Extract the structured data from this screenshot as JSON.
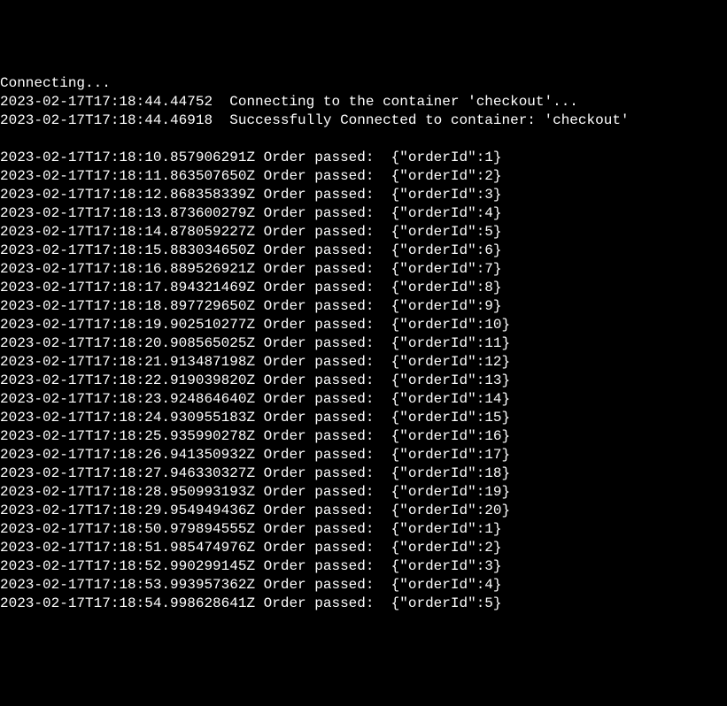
{
  "header": {
    "connecting_status": "Connecting...",
    "lines": [
      {
        "timestamp": "2023-02-17T17:18:44.44752",
        "message": "Connecting to the container 'checkout'..."
      },
      {
        "timestamp": "2023-02-17T17:18:44.46918",
        "message": "Successfully Connected to container: 'checkout'"
      }
    ]
  },
  "log_lines": [
    {
      "timestamp": "2023-02-17T17:18:10.857906291Z",
      "label": "Order passed:",
      "payload": "{\"orderId\":1}"
    },
    {
      "timestamp": "2023-02-17T17:18:11.863507650Z",
      "label": "Order passed:",
      "payload": "{\"orderId\":2}"
    },
    {
      "timestamp": "2023-02-17T17:18:12.868358339Z",
      "label": "Order passed:",
      "payload": "{\"orderId\":3}"
    },
    {
      "timestamp": "2023-02-17T17:18:13.873600279Z",
      "label": "Order passed:",
      "payload": "{\"orderId\":4}"
    },
    {
      "timestamp": "2023-02-17T17:18:14.878059227Z",
      "label": "Order passed:",
      "payload": "{\"orderId\":5}"
    },
    {
      "timestamp": "2023-02-17T17:18:15.883034650Z",
      "label": "Order passed:",
      "payload": "{\"orderId\":6}"
    },
    {
      "timestamp": "2023-02-17T17:18:16.889526921Z",
      "label": "Order passed:",
      "payload": "{\"orderId\":7}"
    },
    {
      "timestamp": "2023-02-17T17:18:17.894321469Z",
      "label": "Order passed:",
      "payload": "{\"orderId\":8}"
    },
    {
      "timestamp": "2023-02-17T17:18:18.897729650Z",
      "label": "Order passed:",
      "payload": "{\"orderId\":9}"
    },
    {
      "timestamp": "2023-02-17T17:18:19.902510277Z",
      "label": "Order passed:",
      "payload": "{\"orderId\":10}"
    },
    {
      "timestamp": "2023-02-17T17:18:20.908565025Z",
      "label": "Order passed:",
      "payload": "{\"orderId\":11}"
    },
    {
      "timestamp": "2023-02-17T17:18:21.913487198Z",
      "label": "Order passed:",
      "payload": "{\"orderId\":12}"
    },
    {
      "timestamp": "2023-02-17T17:18:22.919039820Z",
      "label": "Order passed:",
      "payload": "{\"orderId\":13}"
    },
    {
      "timestamp": "2023-02-17T17:18:23.924864640Z",
      "label": "Order passed:",
      "payload": "{\"orderId\":14}"
    },
    {
      "timestamp": "2023-02-17T17:18:24.930955183Z",
      "label": "Order passed:",
      "payload": "{\"orderId\":15}"
    },
    {
      "timestamp": "2023-02-17T17:18:25.935990278Z",
      "label": "Order passed:",
      "payload": "{\"orderId\":16}"
    },
    {
      "timestamp": "2023-02-17T17:18:26.941350932Z",
      "label": "Order passed:",
      "payload": "{\"orderId\":17}"
    },
    {
      "timestamp": "2023-02-17T17:18:27.946330327Z",
      "label": "Order passed:",
      "payload": "{\"orderId\":18}"
    },
    {
      "timestamp": "2023-02-17T17:18:28.950993193Z",
      "label": "Order passed:",
      "payload": "{\"orderId\":19}"
    },
    {
      "timestamp": "2023-02-17T17:18:29.954949436Z",
      "label": "Order passed:",
      "payload": "{\"orderId\":20}"
    },
    {
      "timestamp": "2023-02-17T17:18:50.979894555Z",
      "label": "Order passed:",
      "payload": "{\"orderId\":1}"
    },
    {
      "timestamp": "2023-02-17T17:18:51.985474976Z",
      "label": "Order passed:",
      "payload": "{\"orderId\":2}"
    },
    {
      "timestamp": "2023-02-17T17:18:52.990299145Z",
      "label": "Order passed:",
      "payload": "{\"orderId\":3}"
    },
    {
      "timestamp": "2023-02-17T17:18:53.993957362Z",
      "label": "Order passed:",
      "payload": "{\"orderId\":4}"
    },
    {
      "timestamp": "2023-02-17T17:18:54.998628641Z",
      "label": "Order passed:",
      "payload": "{\"orderId\":5}"
    }
  ]
}
